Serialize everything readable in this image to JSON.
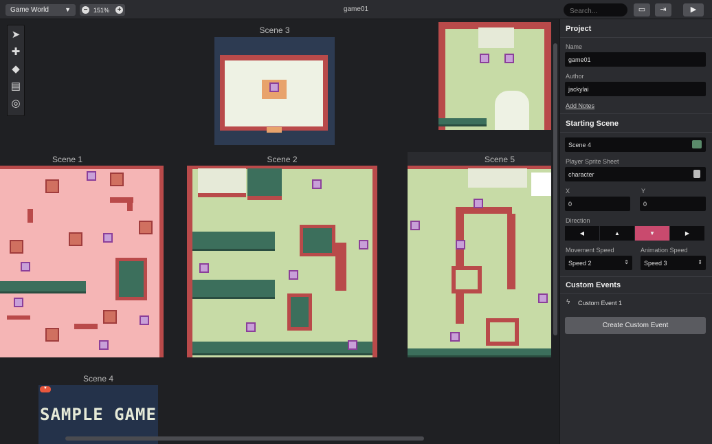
{
  "topbar": {
    "world_select": "Game World",
    "zoom_value": "151%",
    "zoom_out": "−",
    "zoom_in": "+",
    "title": "game01",
    "search_placeholder": "Search...",
    "icons": [
      "folder-icon",
      "export-icon",
      "play-icon"
    ]
  },
  "tools": [
    "select-icon",
    "add-icon",
    "eraser-icon",
    "paint-icon",
    "palette-icon"
  ],
  "canvas": {
    "scenes": [
      {
        "label": "Scene 3"
      },
      {
        "label": "Scene 1"
      },
      {
        "label": "Scene 2"
      },
      {
        "label": "Scene 5"
      },
      {
        "label": "Scene 4"
      }
    ],
    "scene4_art_text": "SAMPLE GAME"
  },
  "panel": {
    "project_header": "Project",
    "name_label": "Name",
    "name_value": "game01",
    "author_label": "Author",
    "author_value": "jackylai",
    "add_notes": "Add Notes",
    "starting_scene_header": "Starting Scene",
    "starting_scene_value": "Scene 4",
    "sprite_sheet_label": "Player Sprite Sheet",
    "sprite_sheet_value": "character",
    "x_label": "X",
    "x_value": "0",
    "y_label": "Y",
    "y_value": "0",
    "direction_label": "Direction",
    "directions": [
      "◀",
      "▲",
      "▼",
      "▶"
    ],
    "direction_selected": "down",
    "movement_speed_label": "Movement Speed",
    "movement_speed_value": "Speed 2",
    "animation_speed_label": "Animation Speed",
    "animation_speed_value": "Speed 3",
    "custom_events_header": "Custom Events",
    "custom_event_1": "Custom Event 1",
    "create_button": "Create Custom Event"
  },
  "colors": {
    "accent": "#c94a6e",
    "grass": "#c7dba6",
    "wall": "#b94a4a",
    "hedge": "#3c6f5c"
  }
}
